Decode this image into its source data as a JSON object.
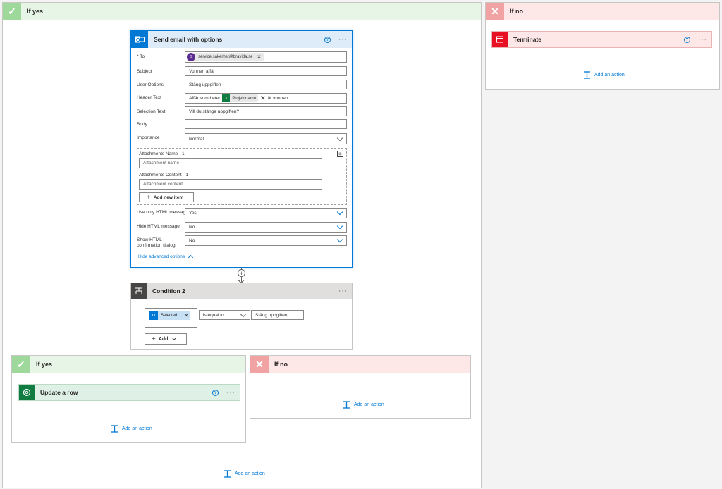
{
  "outer_yes": {
    "title": "If yes"
  },
  "outer_no": {
    "title": "If no"
  },
  "terminate": {
    "title": "Terminate",
    "add_action": "Add an action"
  },
  "send_email": {
    "title": "Send email with options",
    "to_label": "* To",
    "to_initial": "S",
    "to_value": "service.sakerhet@bravida.se",
    "subject_label": "Subject",
    "subject_value": "Vunnen affär",
    "user_options_label": "User Options",
    "user_options_value": "Stäng uppgiften",
    "header_text_label": "Header Text",
    "header_text_prefix": "Affär som heter",
    "header_token": "Projektnamn",
    "header_text_suffix": "är vunnen",
    "selection_text_label": "Selection Text",
    "selection_text_value": "Vill du stänga uppgiften?",
    "body_label": "Body",
    "body_value": "",
    "importance_label": "Importance",
    "importance_value": "Normal",
    "attach_name_label": "Attachments Name - 1",
    "attach_name_placeholder": "Attachment name",
    "attach_content_label": "Attachments Content - 1",
    "attach_content_placeholder": "Attachment content",
    "add_new_item": "Add new item",
    "use_html_label": "Use only HTML message",
    "use_html_value": "Yes",
    "hide_html_label": "Hide HTML message",
    "hide_html_value": "No",
    "show_html_label_1": "Show HTML",
    "show_html_label_2": "confirmation dialog",
    "show_html_value": "No",
    "hide_advanced": "Hide advanced options"
  },
  "condition2": {
    "title": "Condition 2",
    "token": "Selected...",
    "operator": "is equal to",
    "value": "Stäng uppgiften",
    "add_label": "Add"
  },
  "inner_yes": {
    "title": "If yes",
    "add_action": "Add an action"
  },
  "inner_no": {
    "title": "If no",
    "add_action": "Add an action"
  },
  "update_row": {
    "title": "Update a row"
  },
  "outer_add_action": "Add an action",
  "colors": {
    "accent": "#0078d4",
    "yes": "#9fd89b",
    "no": "#f1a3a3",
    "terminate": "#e81123",
    "dataverse": "#107c41"
  }
}
